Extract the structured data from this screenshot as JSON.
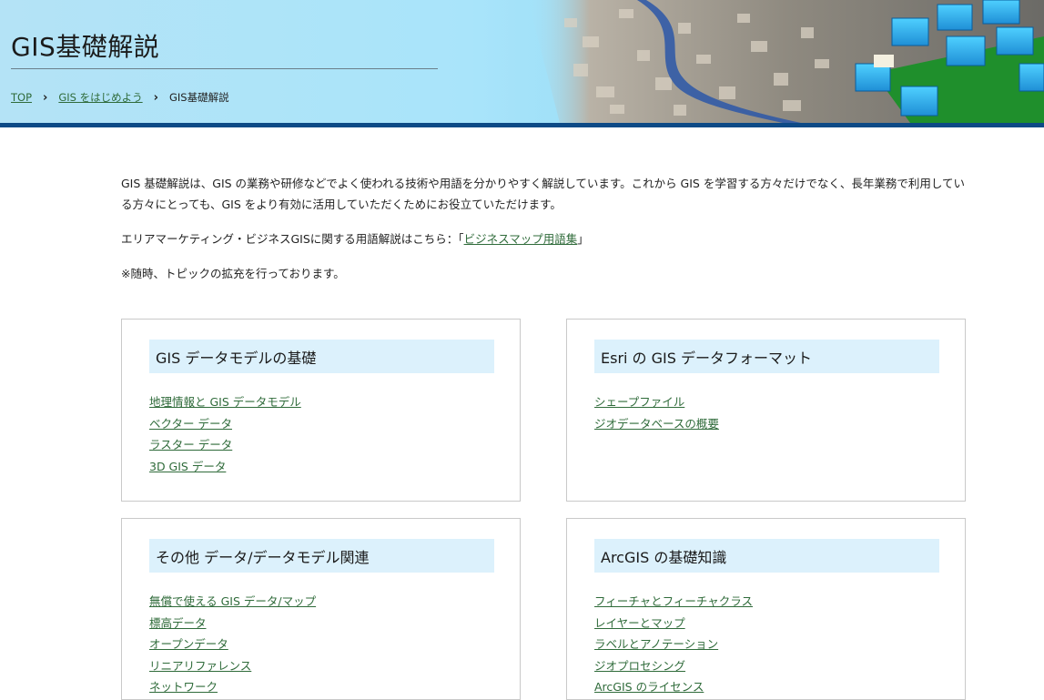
{
  "header": {
    "title": "GIS基礎解説",
    "breadcrumb": [
      {
        "label": "TOP"
      },
      {
        "label": "GIS をはじめよう"
      },
      {
        "label": "GIS基礎解説"
      }
    ]
  },
  "intro": {
    "paragraph1": "GIS 基礎解説は、GIS の業務や研修などでよく使われる技術や用語を分かりやすく解説しています。これから GIS を学習する方々だけでなく、長年業務で利用している方々にとっても、GIS をより有効に活用していただくためにお役立ていただけます。",
    "paragraph2_prefix": "エリアマーケティング・ビジネスGISに関する用語解説はこちら：「",
    "paragraph2_link": "ビジネスマップ用語集",
    "paragraph2_suffix": "」",
    "note": "※随時、トピックの拡充を行っております。"
  },
  "cards": [
    {
      "title": "GIS データモデルの基礎",
      "links": [
        "地理情報と GIS データモデル",
        "ベクター データ",
        "ラスター データ",
        "3D GIS データ"
      ]
    },
    {
      "title": "Esri の GIS データフォーマット",
      "links": [
        "シェープファイル",
        "ジオデータベースの概要"
      ]
    },
    {
      "title": "その他 データ/データモデル関連",
      "links": [
        "無償で使える GIS データ/マップ",
        "標高データ",
        "オープンデータ",
        "リニアリファレンス",
        "ネットワーク"
      ]
    },
    {
      "title": "ArcGIS の基礎知識",
      "links": [
        "フィーチャとフィーチャクラス",
        "レイヤーとマップ",
        "ラベルとアノテーション",
        "ジオプロセシング",
        "ArcGIS のライセンス"
      ]
    }
  ],
  "colors": {
    "banner_bar": "#0d4a86",
    "card_heading_bg": "#dcf1fc",
    "link": "#2f6b3a"
  }
}
